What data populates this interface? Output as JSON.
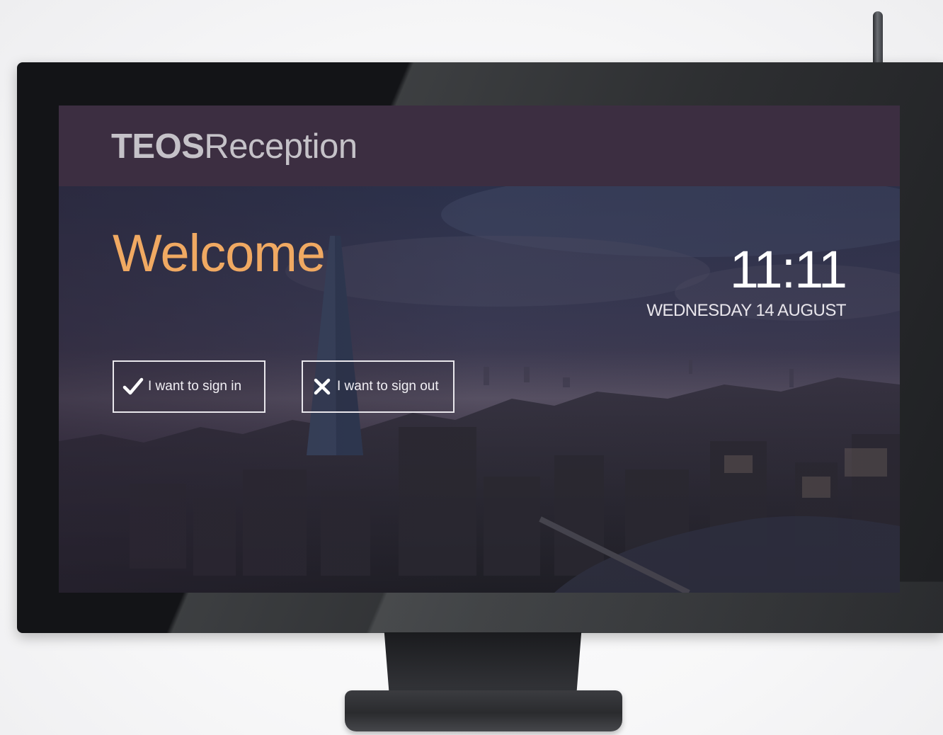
{
  "screen": {
    "brand_bold": "TEOS",
    "brand_light": "Reception",
    "welcome": "Welcome",
    "time": "11:11",
    "date": "WEDNESDAY 14 AUGUST",
    "sign_in_label": "I want to sign in",
    "sign_out_label": "I want to sign out",
    "sign_in_icon": "checkmark-icon",
    "sign_out_icon": "cross-icon"
  },
  "colors": {
    "header": "#3c2e41",
    "welcome": "#f0a962",
    "text": "#ffffff"
  }
}
